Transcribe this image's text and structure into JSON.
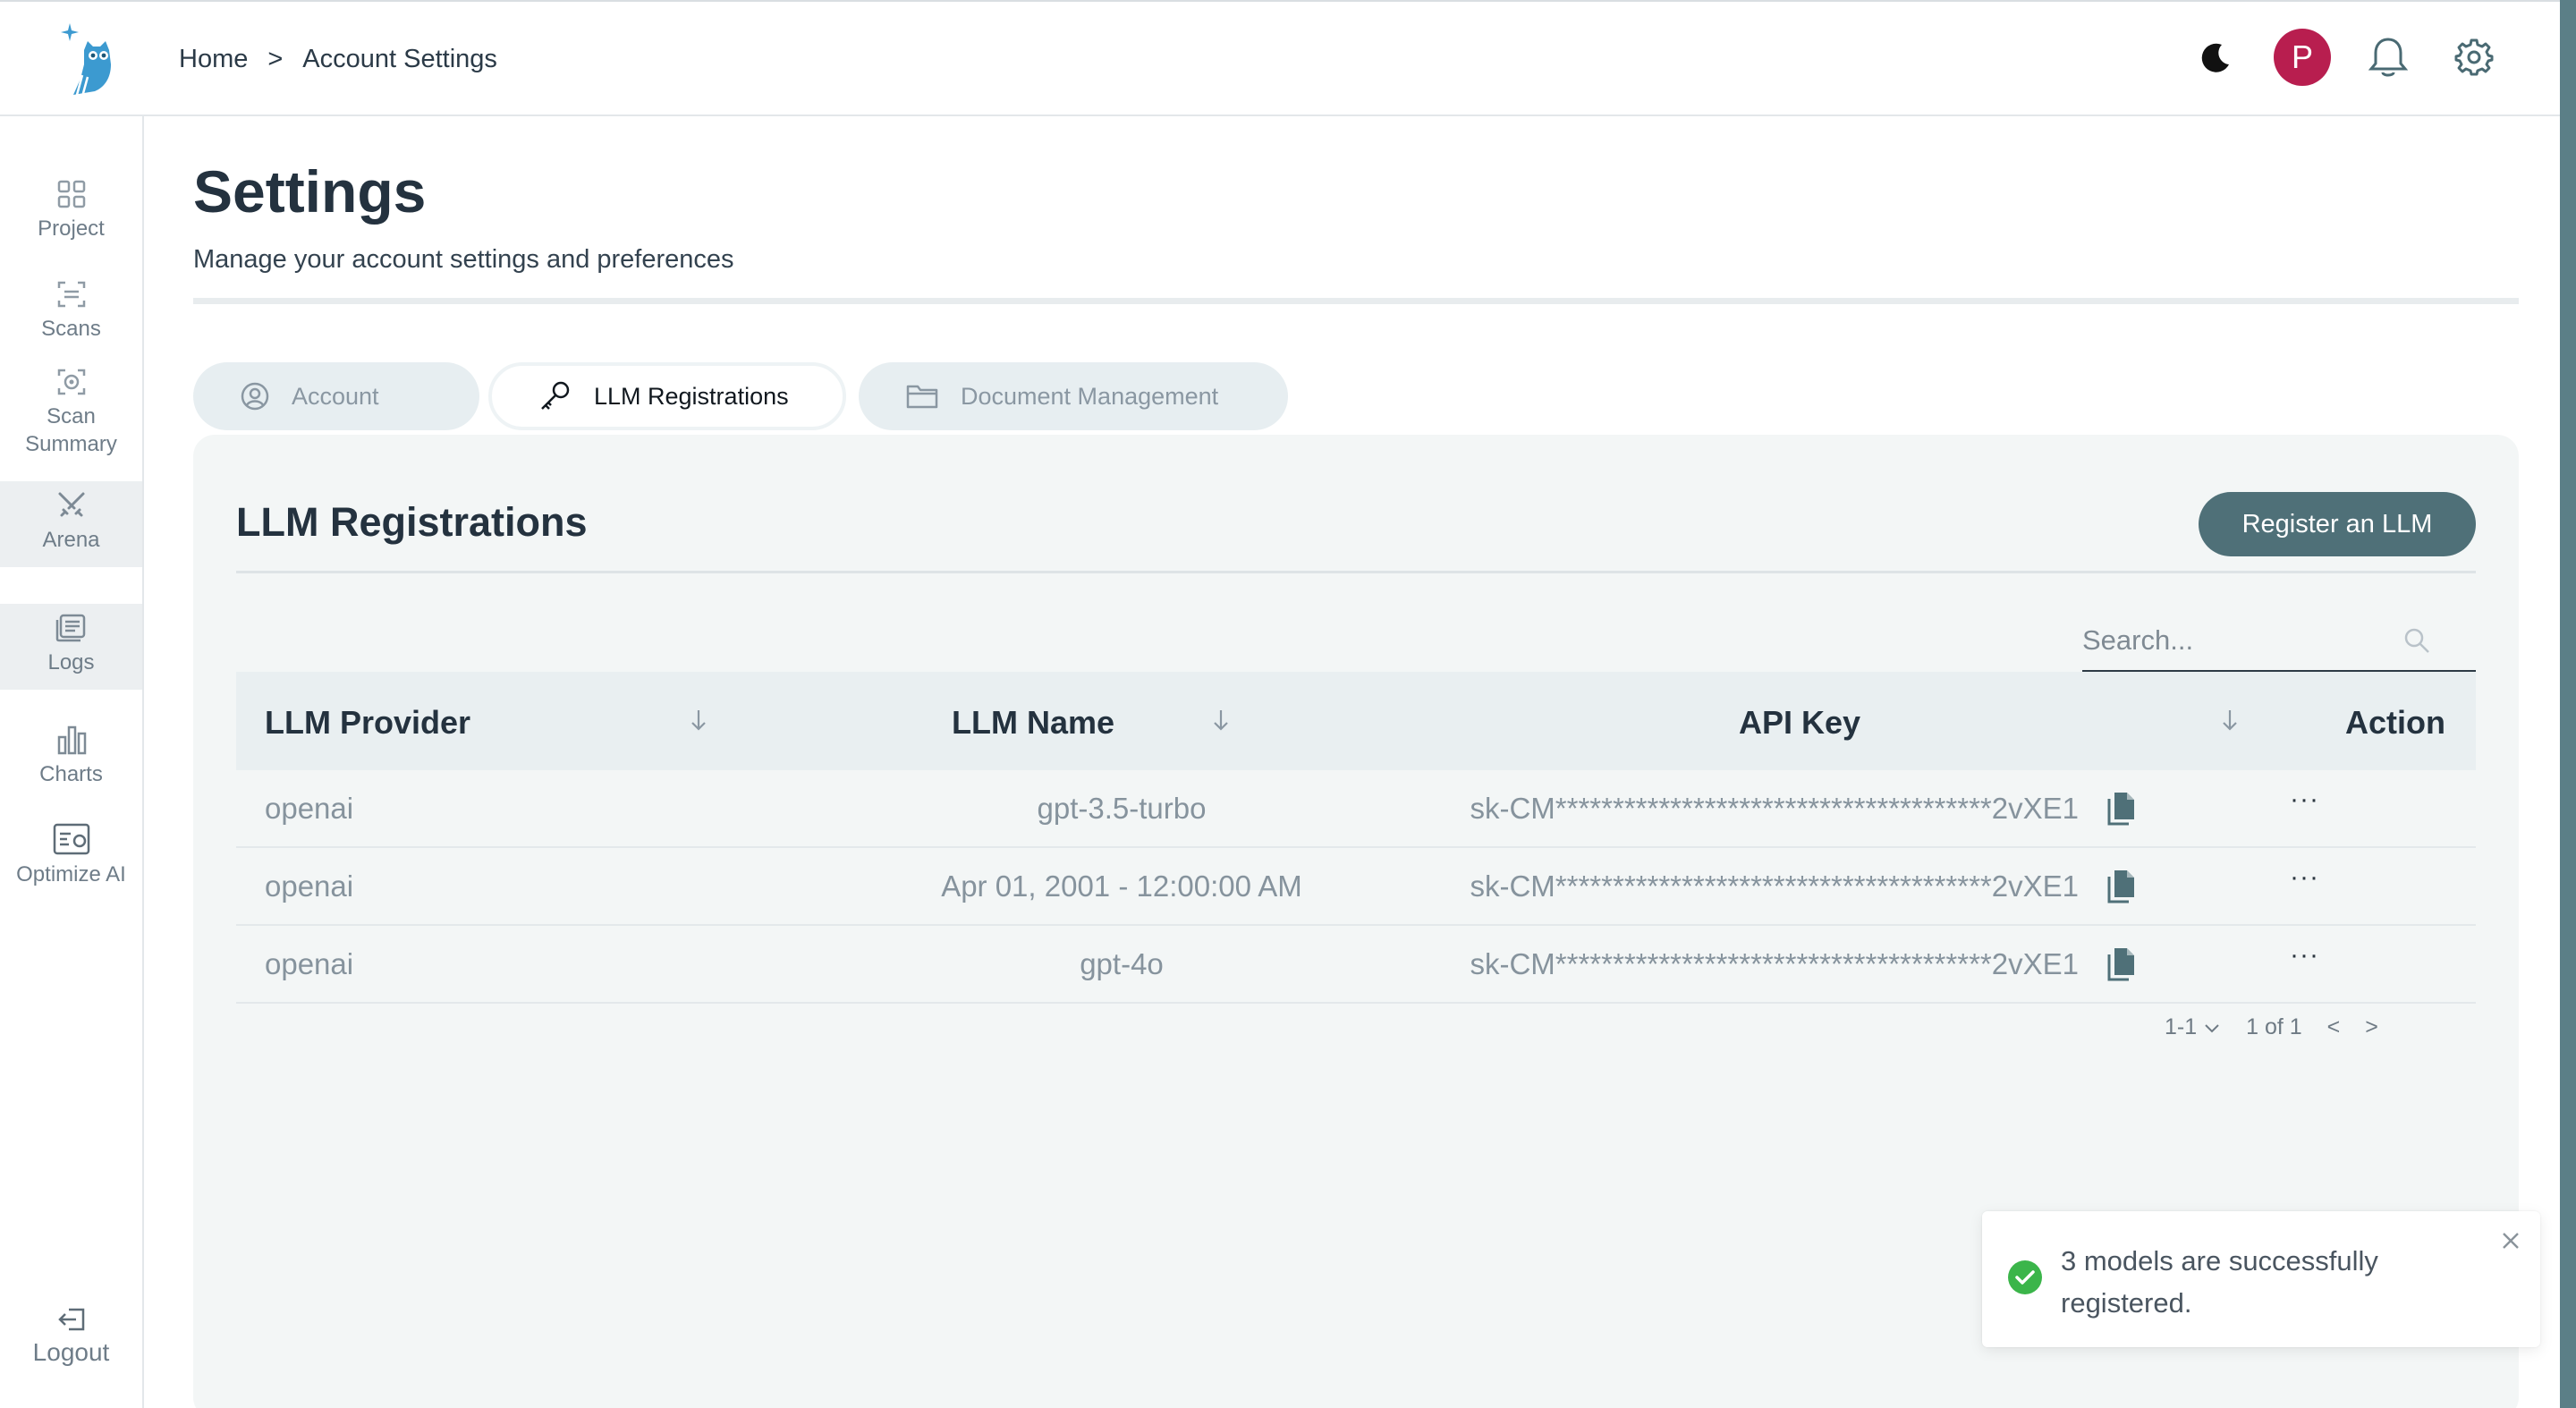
{
  "breadcrumb": {
    "home": "Home",
    "separator": ">",
    "current": "Account Settings"
  },
  "header": {
    "avatar_initial": "P",
    "icons": [
      "moon-icon",
      "bell-icon",
      "gear-icon"
    ]
  },
  "sidebar": {
    "items": [
      {
        "label": "Project",
        "icon": "grid-icon"
      },
      {
        "label": "Scans",
        "icon": "scan-icon"
      },
      {
        "label": "Scan Summary",
        "icon": "scan-summary-icon"
      },
      {
        "label": "Arena",
        "icon": "swords-icon",
        "active": true
      },
      {
        "label": "Logs",
        "icon": "logs-icon",
        "active": true
      },
      {
        "label": "Charts",
        "icon": "bar-chart-icon"
      },
      {
        "label": "Optimize AI",
        "icon": "optimize-icon"
      }
    ],
    "logout": "Logout"
  },
  "page": {
    "title": "Settings",
    "subtitle": "Manage your account settings and preferences"
  },
  "tabs": [
    {
      "label": "Account",
      "icon": "user-circle-icon",
      "active": false
    },
    {
      "label": "LLM Registrations",
      "icon": "key-icon",
      "active": true
    },
    {
      "label": "Document Management",
      "icon": "folder-icon",
      "active": false
    }
  ],
  "panel": {
    "title": "LLM Registrations",
    "register_button": "Register an LLM",
    "search_placeholder": "Search..."
  },
  "table": {
    "columns": [
      "LLM Provider",
      "LLM Name",
      "API Key",
      "Action"
    ],
    "rows": [
      {
        "provider": "openai",
        "name": "gpt-3.5-turbo",
        "api_key": "sk-CM**************************************2vXE1"
      },
      {
        "provider": "openai",
        "name": "Apr 01, 2001 - 12:00:00 AM",
        "api_key": "sk-CM**************************************2vXE1"
      },
      {
        "provider": "openai",
        "name": "gpt-4o",
        "api_key": "sk-CM**************************************2vXE1"
      }
    ],
    "action_label": "···"
  },
  "pagination": {
    "range": "1-1",
    "page_info": "1 of 1",
    "prev": "<",
    "next": ">"
  },
  "toast": {
    "message": "3 models are successfully registered."
  },
  "colors": {
    "accent": "#4f7078",
    "avatar": "#b81e4f",
    "success": "#3bb54a",
    "brand_logo": "#3c9ad0"
  }
}
